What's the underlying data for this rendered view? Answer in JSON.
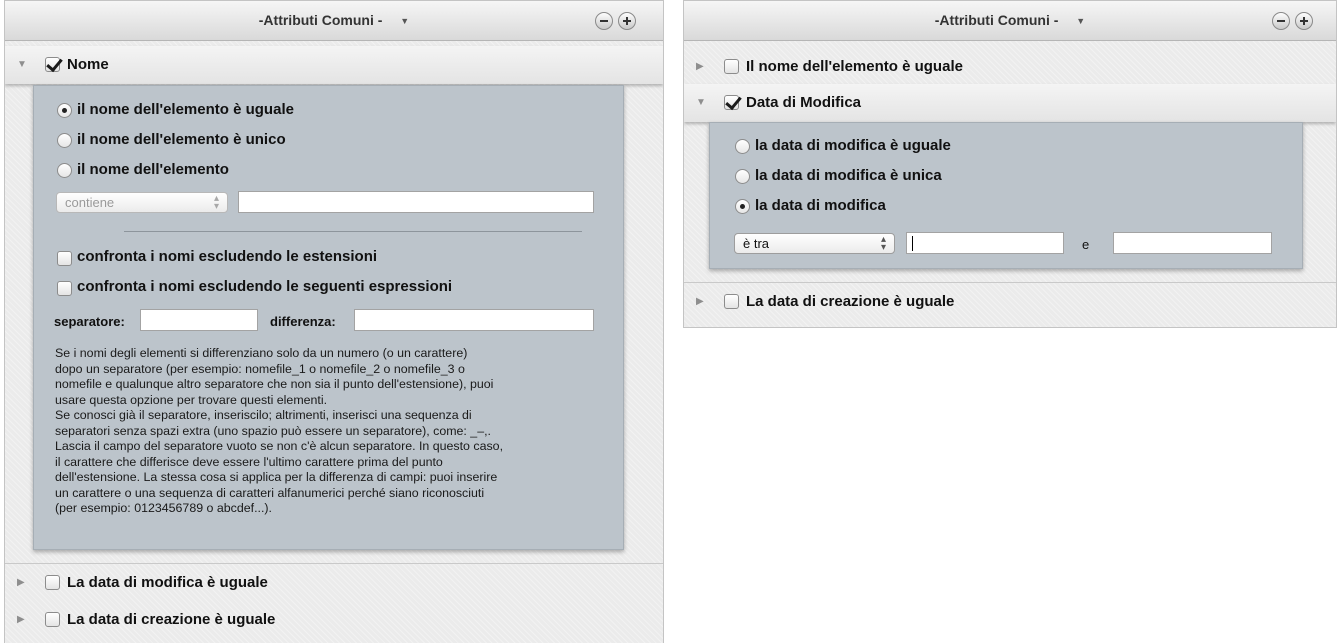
{
  "left": {
    "title": "-Attributi Comuni -",
    "nome_row": {
      "label": "Nome",
      "checked": true
    },
    "options": [
      {
        "label": "il nome dell'elemento è uguale",
        "selected": true
      },
      {
        "label": "il nome dell'elemento è unico",
        "selected": false
      },
      {
        "label": "il nome dell'elemento",
        "selected": false
      }
    ],
    "condition_select": "contiene",
    "condition_value": "",
    "exclude_extensions_label": "confronta i nomi escludendo le estensioni",
    "exclude_expressions_label": "confronta i nomi escludendo le seguenti espressioni",
    "separator_label": "separatore:",
    "separator_value": "",
    "difference_label": "differenza:",
    "difference_value": "",
    "help_text": "Se i nomi degli elementi si differenziano solo da un numero (o un carattere)\ndopo un separatore (per esempio: nomefile_1 o nomefile_2 o nomefile_3 o\nnomefile e qualunque altro separatore che non sia il punto dell'estensione), puoi\nusare questa opzione per trovare questi elementi.\nSe conosci già il separatore, inseriscilo; altrimenti, inserisci una sequenza di\nseparatori senza spazi extra (uno spazio può essere un separatore), come: _–,.\nLascia il campo del separatore vuoto se non c'è alcun separatore. In questo caso,\nil carattere che differisce deve essere l'ultimo carattere prima del punto\ndell'estensione. La stessa cosa si applica per la differenza di campi: puoi inserire\nun carattere o una sequenza di caratteri alfanumerici perché siano riconosciuti\n(per esempio: 0123456789 o abcdef...).",
    "collapsed_rows": [
      {
        "label": "La data di modifica è uguale",
        "checked": false
      },
      {
        "label": "La data di creazione è uguale",
        "checked": false
      }
    ]
  },
  "right": {
    "title": "-Attributi Comuni -",
    "name_row": {
      "label": "Il nome dell'elemento è uguale",
      "checked": false
    },
    "data_row": {
      "label": "Data di Modifica",
      "checked": true
    },
    "options": [
      {
        "label": "la data di modifica è uguale",
        "selected": false
      },
      {
        "label": "la data di modifica è unica",
        "selected": false
      },
      {
        "label": "la data di modifica",
        "selected": true
      }
    ],
    "range_select": "è tra",
    "range_from": "",
    "range_and_label": "e",
    "range_to": "",
    "creation_row": {
      "label": "La data di creazione è uguale",
      "checked": false
    }
  },
  "icons": {
    "disclosure_open": "disclosure-triangle-down",
    "disclosure_closed": "disclosure-triangle-right",
    "remove": "minus-circle",
    "add": "plus-circle",
    "title_menu": "menu-arrow-down"
  },
  "colors": {
    "inner_panel": "#bcc4cb",
    "panel_bg": "#ebebeb"
  }
}
